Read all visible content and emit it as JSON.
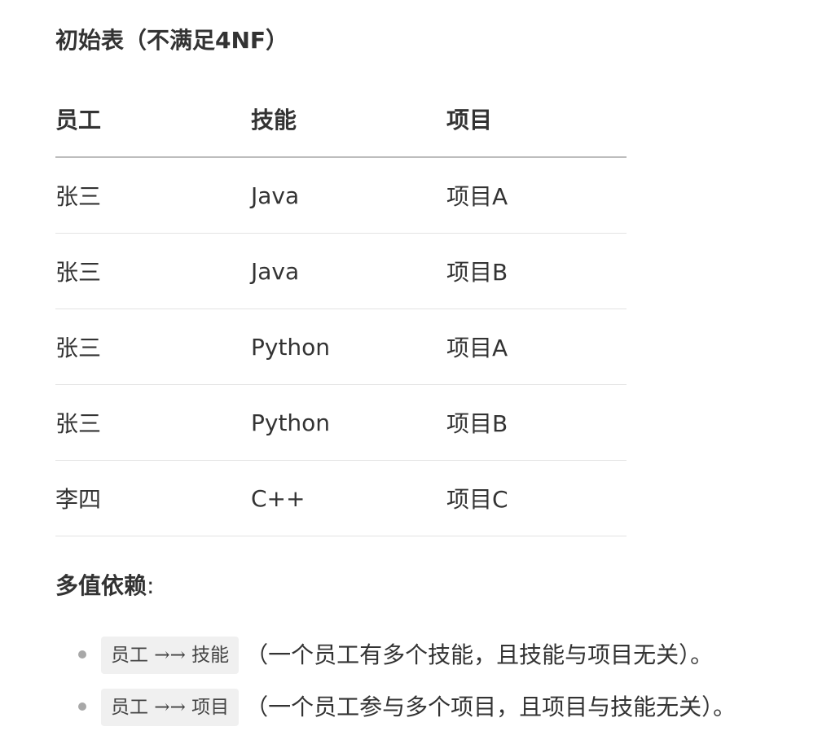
{
  "section_title": "初始表（不满足4NF）",
  "table": {
    "headers": [
      "员工",
      "技能",
      "项目"
    ],
    "rows": [
      [
        "张三",
        "Java",
        "项目A"
      ],
      [
        "张三",
        "Java",
        "项目B"
      ],
      [
        "张三",
        "Python",
        "项目A"
      ],
      [
        "张三",
        "Python",
        "项目B"
      ],
      [
        "李四",
        "C++",
        "项目C"
      ]
    ]
  },
  "mvd": {
    "label": "多值依赖",
    "colon": ":",
    "items": [
      {
        "code": "员工 →→ 技能",
        "desc": "（一个员工有多个技能，且技能与项目无关）。"
      },
      {
        "code": "员工 →→ 项目",
        "desc": "（一个员工参与多个项目，且项目与技能无关）。"
      }
    ]
  }
}
